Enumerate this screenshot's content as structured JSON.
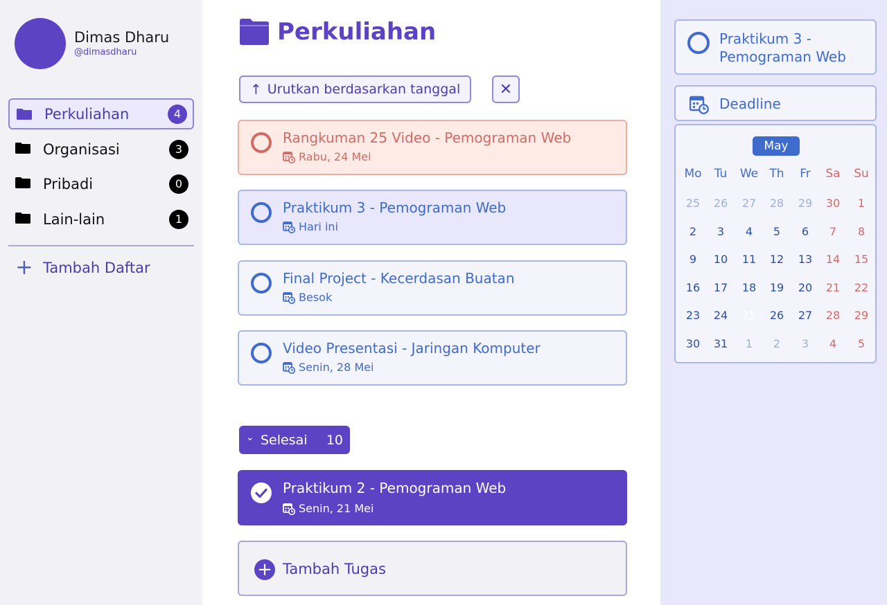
{
  "user": {
    "name": "Dimas Dharu",
    "handle": "@dimasdharu"
  },
  "sidebar": {
    "items": [
      {
        "label": "Perkuliahan",
        "count": "4"
      },
      {
        "label": "Organisasi",
        "count": "3"
      },
      {
        "label": "Pribadi",
        "count": "0"
      },
      {
        "label": "Lain-lain",
        "count": "1"
      }
    ],
    "add_label": "Tambah Daftar"
  },
  "main": {
    "title": "Perkuliahan",
    "sort_label": "Urutkan berdasarkan tanggal",
    "clear_icon": "✕",
    "tasks": [
      {
        "title": "Rangkuman 25 Video - Pemograman Web",
        "date": "Rabu, 24 Mei",
        "status": "overdue"
      },
      {
        "title": "Praktikum 3 - Pemograman Web",
        "date": "Hari ini",
        "status": "today"
      },
      {
        "title": "Final Project - Kecerdasan Buatan",
        "date": "Besok",
        "status": "upcoming"
      },
      {
        "title": "Video Presentasi - Jaringan Komputer",
        "date": "Senin, 28 Mei",
        "status": "upcoming"
      }
    ],
    "done_section": {
      "label": "Selesai",
      "count": "10"
    },
    "done_tasks": [
      {
        "title": "Praktikum 2 - Pemograman Web",
        "date": "Senin, 21 Mei"
      }
    ],
    "add_task_label": "Tambah Tugas"
  },
  "detail": {
    "title": "Praktikum 3 - Pemograman Web",
    "deadline_label": "Deadline",
    "calendar": {
      "month": "May",
      "weekdays": [
        "Mo",
        "Tu",
        "We",
        "Th",
        "Fr",
        "Sa",
        "Su"
      ],
      "weeks": [
        [
          "25",
          "26",
          "27",
          "28",
          "29",
          "30",
          "1"
        ],
        [
          "2",
          "3",
          "4",
          "5",
          "6",
          "7",
          "8"
        ],
        [
          "9",
          "10",
          "11",
          "12",
          "13",
          "14",
          "15"
        ],
        [
          "16",
          "17",
          "18",
          "19",
          "20",
          "21",
          "22"
        ],
        [
          "23",
          "24",
          "25",
          "26",
          "27",
          "28",
          "29"
        ],
        [
          "30",
          "31",
          "1",
          "2",
          "3",
          "4",
          "5"
        ]
      ],
      "selected_day": "25"
    }
  },
  "colors": {
    "primary": "#5b43c4",
    "blue": "#3f6bcc",
    "overdue": "#d46a64",
    "panel_bg": "#e9e7fb"
  }
}
